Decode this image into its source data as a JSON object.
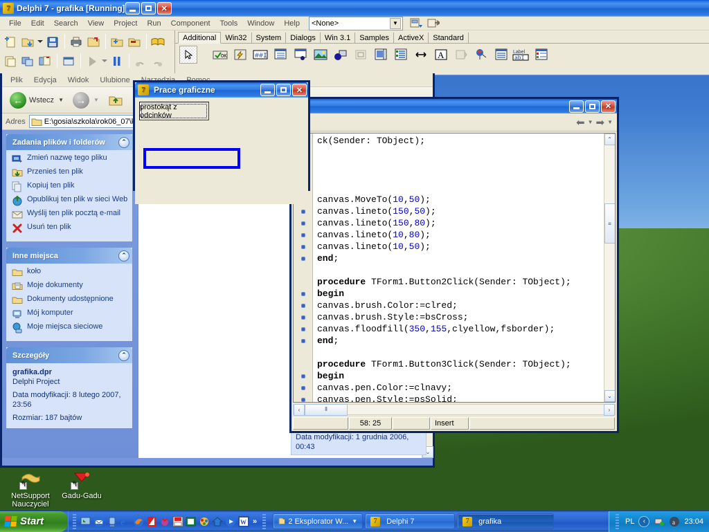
{
  "desktop": {
    "icons": [
      {
        "label": "NetSupport Nauczyciel",
        "icon": "netsupport-icon"
      },
      {
        "label": "Gadu-Gadu",
        "icon": "gadugadu-icon"
      }
    ]
  },
  "delphi": {
    "title": "Delphi 7 - grafika [Running]",
    "logo_text": "7",
    "menu": [
      "File",
      "Edit",
      "Search",
      "View",
      "Project",
      "Run",
      "Component",
      "Tools",
      "Window",
      "Help"
    ],
    "combo_value": "<None>",
    "toolbar_icons": [
      "new-item-icon",
      "open-project-icon",
      "open-dropdown-icon",
      "save-icon",
      "save-all-icon",
      "open-file-icon",
      "add-to-project-icon",
      "remove-from-project-icon",
      "help-contents-icon",
      "new-form-icon",
      "toggle-form-unit-icon",
      "view-unit-icon",
      "view-form-icon",
      "run-icon",
      "run-dropdown-icon",
      "pause-icon",
      "trace-into-icon",
      "step-over-icon"
    ],
    "palette_tabs": [
      {
        "label": "Additional",
        "active": true
      },
      {
        "label": "Win32",
        "active": false
      },
      {
        "label": "System",
        "active": false
      },
      {
        "label": "Dialogs",
        "active": false
      },
      {
        "label": "Win 3.1",
        "active": false
      },
      {
        "label": "Samples",
        "active": false
      },
      {
        "label": "ActiveX",
        "active": false
      },
      {
        "label": "Standard",
        "active": false
      }
    ],
    "palette_icons": [
      "pointer-icon",
      "bitbtn-icon",
      "speedbutton-icon",
      "maskedit-icon",
      "stringgrid-icon",
      "drawgrid-icon",
      "image-icon",
      "shape-icon",
      "bevel-icon",
      "scrollbox-icon",
      "checklistbox-icon",
      "splitter-icon",
      "statictext-icon",
      "controlbar-icon",
      "applicationevents-icon",
      "valuelisteditor-icon",
      "labelededit-icon",
      "colorbox-icon"
    ]
  },
  "explorer": {
    "menu": [
      "Plik",
      "Edycja",
      "Widok",
      "Ulubione",
      "Narzędzia",
      "Pomoc"
    ],
    "back_label": "Wstecz",
    "address_label": "Adres",
    "address_value": "E:\\gosia\\szkola\\rok06_07\\k",
    "panels": [
      {
        "title": "Zadania plików i folderów",
        "items": [
          {
            "label": "Zmień nazwę tego pliku",
            "icon": "rename-file-icon"
          },
          {
            "label": "Przenieś ten plik",
            "icon": "move-file-icon"
          },
          {
            "label": "Kopiuj ten plik",
            "icon": "copy-file-icon"
          },
          {
            "label": "Opublikuj ten plik w sieci Web",
            "icon": "publish-web-icon"
          },
          {
            "label": "Wyślij ten plik pocztą e-mail",
            "icon": "email-file-icon"
          },
          {
            "label": "Usuń ten plik",
            "icon": "delete-file-icon"
          }
        ]
      },
      {
        "title": "Inne miejsca",
        "items": [
          {
            "label": "koło",
            "icon": "folder-icon"
          },
          {
            "label": "Moje dokumenty",
            "icon": "my-documents-icon"
          },
          {
            "label": "Dokumenty udostępnione",
            "icon": "shared-documents-icon"
          },
          {
            "label": "Mój komputer",
            "icon": "my-computer-icon"
          },
          {
            "label": "Moje miejsca sieciowe",
            "icon": "network-places-icon"
          }
        ]
      }
    ],
    "details": {
      "title": "Szczegóły",
      "filename": "grafika.dpr",
      "filetype": "Delphi Project",
      "modified": "Data modyfikacji: 8 lutego 2007, 23:56",
      "size": "Rozmiar: 187 bajtów"
    },
    "detail_tooltip": "Data modyfikacji: 1 grudnia 2006, 00:43"
  },
  "code_editor": {
    "title": "",
    "lines": [
      {
        "marker": false,
        "text": "ck(Sender: TObject);",
        "bold_head": ""
      },
      {
        "marker": false,
        "text": ""
      },
      {
        "marker": false,
        "text": ""
      },
      {
        "marker": false,
        "text": ""
      },
      {
        "marker": false,
        "text": ""
      },
      {
        "marker": true,
        "text": "canvas.MoveTo(10,50);"
      },
      {
        "marker": true,
        "text": "canvas.lineto(150,50);"
      },
      {
        "marker": true,
        "text": "canvas.lineto(150,80);"
      },
      {
        "marker": true,
        "text": "canvas.lineto(10,80);"
      },
      {
        "marker": true,
        "text": "canvas.lineto(10,50);"
      },
      {
        "marker": true,
        "text": "end;"
      },
      {
        "marker": false,
        "text": ""
      },
      {
        "marker": false,
        "text": "procedure TForm1.Button2Click(Sender: TObject);"
      },
      {
        "marker": true,
        "text": "begin"
      },
      {
        "marker": true,
        "text": "canvas.brush.Color:=clred;"
      },
      {
        "marker": true,
        "text": "canvas.brush.Style:=bsCross;"
      },
      {
        "marker": true,
        "text": "canvas.floodfill(350,155,clyellow,fsborder);"
      },
      {
        "marker": true,
        "text": "end;"
      },
      {
        "marker": false,
        "text": ""
      },
      {
        "marker": false,
        "text": "procedure TForm1.Button3Click(Sender: TObject);"
      },
      {
        "marker": true,
        "text": "begin"
      },
      {
        "marker": true,
        "text": "canvas.pen.Color:=clnavy;"
      },
      {
        "marker": true,
        "text": "canvas.pen.Style:=psSolid;"
      }
    ],
    "status": {
      "cursor": "58: 25",
      "mode": "Insert"
    }
  },
  "dialog": {
    "title": "Prace graficzne",
    "button_label": "prostokąt z odcinków",
    "rect_color": "#0000ff"
  },
  "taskbar": {
    "start_label": "Start",
    "quicklaunch": [
      "show-desktop-icon",
      "outlook-express-icon",
      "windows-media-icon",
      "internet-explorer-icon",
      "firefox-icon",
      "acrobat-reader-icon",
      "winamp-icon",
      "save-disk-icon",
      "excel-icon",
      "paint-icon",
      "home-icon",
      "media-player-icon",
      "word-icon"
    ],
    "overflow_label": "»",
    "buttons": [
      {
        "label": "2 Eksplorator W...",
        "icon": "folder-icon",
        "active": false,
        "has_caret": true
      },
      {
        "label": "Delphi 7",
        "icon": "delphi-icon",
        "active": false,
        "has_caret": false
      },
      {
        "label": "grafika",
        "icon": "delphi-icon",
        "active": true,
        "has_caret": false
      }
    ],
    "tray": {
      "language": "PL",
      "icons": [
        "tray-chevron-icon",
        "network-icon",
        "antivirus-icon"
      ],
      "clock": "23:04"
    }
  },
  "colors": {
    "xp_blue": "#2a6fd8",
    "title_gradient_start": "#0a5ad8",
    "taskbar_blue": "#2258c4",
    "start_green": "#31801f",
    "panel_bg": "#d6e3f8",
    "link_blue": "#1a3c8c",
    "ide_face": "#ece9d8"
  }
}
